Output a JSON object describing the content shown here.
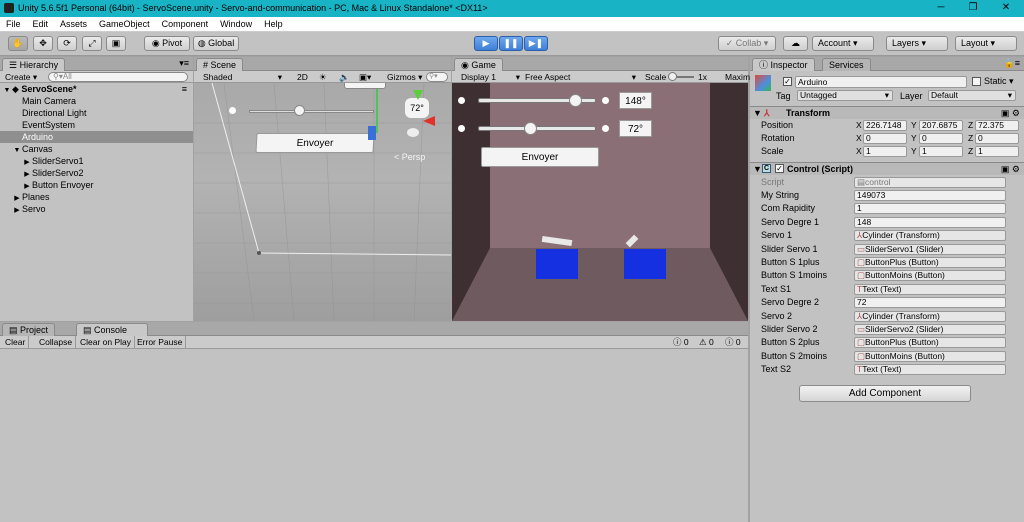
{
  "window": {
    "title": "Unity 5.6.5f1 Personal (64bit) - ServoScene.unity - Servo-and-communication - PC, Mac & Linux Standalone* <DX11>"
  },
  "menu": [
    "File",
    "Edit",
    "Assets",
    "GameObject",
    "Component",
    "Window",
    "Help"
  ],
  "toolbar": {
    "pivot": "Pivot",
    "global": "Global",
    "collab": "Collab",
    "account": "Account",
    "layers": "Layers",
    "layout": "Layout"
  },
  "hierarchy": {
    "tab": "Hierarchy",
    "create": "Create",
    "search_placeholder": "All",
    "items": [
      {
        "label": "ServoScene*",
        "depth": 0,
        "arrow": "▼",
        "bold": true
      },
      {
        "label": "Main Camera",
        "depth": 1,
        "arrow": ""
      },
      {
        "label": "Directional Light",
        "depth": 1,
        "arrow": ""
      },
      {
        "label": "EventSystem",
        "depth": 1,
        "arrow": ""
      },
      {
        "label": "Arduino",
        "depth": 1,
        "arrow": "",
        "selected": true
      },
      {
        "label": "Canvas",
        "depth": 1,
        "arrow": "▼"
      },
      {
        "label": "SliderServo1",
        "depth": 2,
        "arrow": "▶"
      },
      {
        "label": "SliderServo2",
        "depth": 2,
        "arrow": "▶"
      },
      {
        "label": "Button Envoyer",
        "depth": 2,
        "arrow": "▶"
      },
      {
        "label": "Planes",
        "depth": 1,
        "arrow": "▶"
      },
      {
        "label": "Servo",
        "depth": 1,
        "arrow": "▶"
      }
    ]
  },
  "scene": {
    "tab": "Scene",
    "shading": "Shaded",
    "mode2d": "2D",
    "gizmos": "Gizmos",
    "button": "Envoyer",
    "persp": "< Persp",
    "partial_value": "72°"
  },
  "game": {
    "tab": "Game",
    "display": "Display 1",
    "aspect": "Free Aspect",
    "scale_label": "Scale",
    "scale_value": "1x",
    "maximize": "Maxim",
    "value1": "148°",
    "value2": "72°",
    "button": "Envoyer",
    "slider1": 0.86,
    "slider2": 0.43
  },
  "bottom": {
    "project_tab": "Project",
    "console_tab": "Console",
    "clear": "Clear",
    "collapse": "Collapse",
    "clear_on_play": "Clear on Play",
    "error_pause": "Error Pause",
    "c1": "0",
    "c2": "0",
    "c3": "0"
  },
  "inspector": {
    "tab": "Inspector",
    "services_tab": "Services",
    "object_name": "Arduino",
    "static": "Static",
    "tag_label": "Tag",
    "tag": "Untagged",
    "layer_label": "Layer",
    "layer": "Default",
    "transform": {
      "title": "Transform",
      "rows": [
        {
          "label": "Position",
          "x": "226.7148",
          "y": "207.6875",
          "z": "72.375"
        },
        {
          "label": "Rotation",
          "x": "0",
          "y": "0",
          "z": "0"
        },
        {
          "label": "Scale",
          "x": "1",
          "y": "1",
          "z": "1"
        }
      ]
    },
    "control": {
      "title": "Control (Script)",
      "script_label": "Script",
      "script_value": "control",
      "fields": [
        {
          "label": "My String",
          "value": "149073",
          "ref": false
        },
        {
          "label": "Com Rapidity",
          "value": "1",
          "ref": false
        },
        {
          "label": "Servo Degre 1",
          "value": "148",
          "ref": false
        },
        {
          "label": "Servo 1",
          "value": "Cylinder (Transform)",
          "ref": true,
          "icon": "transform"
        },
        {
          "label": "Slider Servo 1",
          "value": "SliderServo1 (Slider)",
          "ref": true,
          "icon": "slider"
        },
        {
          "label": "Button S 1plus",
          "value": "ButtonPlus (Button)",
          "ref": true,
          "icon": "button"
        },
        {
          "label": "Button S 1moins",
          "value": "ButtonMoins (Button)",
          "ref": true,
          "icon": "button"
        },
        {
          "label": "Text S1",
          "value": "Text (Text)",
          "ref": true,
          "icon": "text"
        },
        {
          "label": "Servo Degre 2",
          "value": "72",
          "ref": false
        },
        {
          "label": "Servo 2",
          "value": "Cylinder (Transform)",
          "ref": true,
          "icon": "transform"
        },
        {
          "label": "Slider Servo 2",
          "value": "SliderServo2 (Slider)",
          "ref": true,
          "icon": "slider"
        },
        {
          "label": "Button S 2plus",
          "value": "ButtonPlus (Button)",
          "ref": true,
          "icon": "button"
        },
        {
          "label": "Button S 2moins",
          "value": "ButtonMoins (Button)",
          "ref": true,
          "icon": "button"
        },
        {
          "label": "Text S2",
          "value": "Text (Text)",
          "ref": true,
          "icon": "text"
        }
      ]
    },
    "add_component": "Add Component"
  },
  "colors": {
    "titlebar": "#18b4c5",
    "game_bg": "#4d3a3e",
    "cube": "#1530e0",
    "selection": "#8f8f8f"
  }
}
